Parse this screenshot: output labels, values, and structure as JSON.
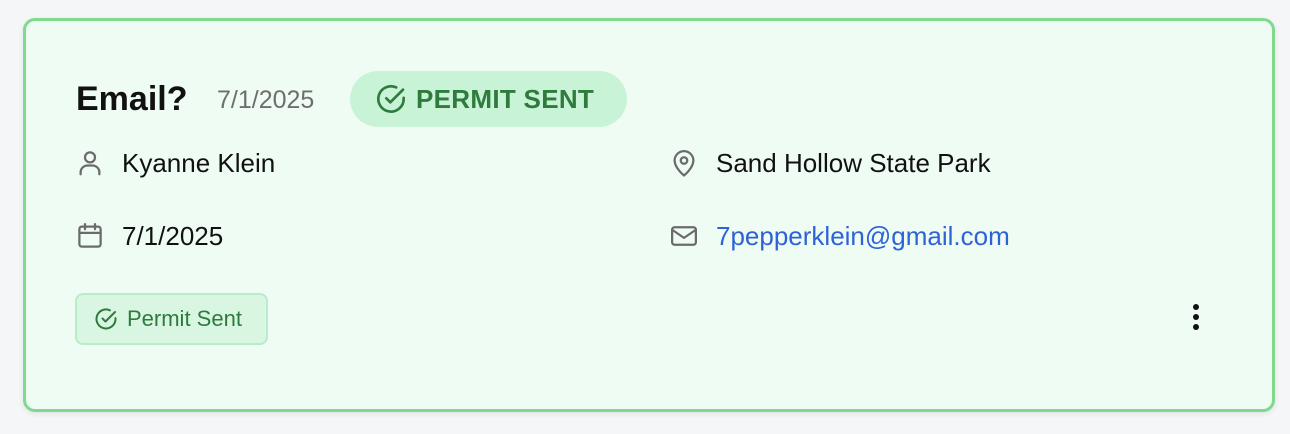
{
  "card": {
    "title": "Email?",
    "title_date": "7/1/2025",
    "status_pill": {
      "label": "PERMIT SENT",
      "icon": "check-circle-icon"
    },
    "details": {
      "person": {
        "icon": "user-icon",
        "value": "Kyanne Klein"
      },
      "date": {
        "icon": "calendar-icon",
        "value": "7/1/2025"
      },
      "location": {
        "icon": "map-pin-icon",
        "value": "Sand Hollow State Park"
      },
      "email": {
        "icon": "mail-icon",
        "value": "7pepperklein@gmail.com"
      }
    },
    "tag": {
      "label": "Permit Sent",
      "icon": "check-circle-icon"
    },
    "menu_icon": "more-vertical-icon"
  },
  "colors": {
    "card_border": "#7fd98f",
    "card_background": "#effcf3",
    "status_background": "#c9f3d6",
    "status_text": "#2f7a3d",
    "link": "#2e63d8"
  }
}
